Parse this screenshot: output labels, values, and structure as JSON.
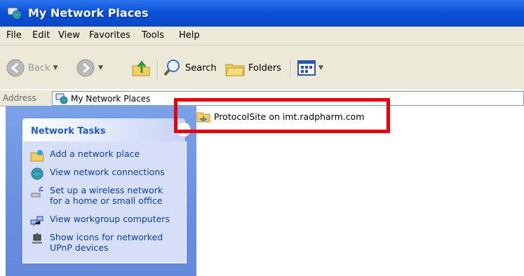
{
  "window": {
    "title": "My Network Places"
  },
  "menu": {
    "items": [
      "File",
      "Edit",
      "View",
      "Favorites",
      "Tools",
      "Help"
    ]
  },
  "toolbar": {
    "back_label": "Back",
    "search_label": "Search",
    "folders_label": "Folders",
    "icons": [
      "back-arrow-icon",
      "forward-arrow-icon",
      "up-folder-icon",
      "search-icon",
      "folders-icon",
      "views-icon"
    ]
  },
  "address": {
    "label": "Address",
    "value": "My Network Places"
  },
  "tasks": {
    "title": "Network Tasks",
    "items": [
      {
        "label": "Add a network place",
        "icon": "add-network-place-icon"
      },
      {
        "label": "View network connections",
        "icon": "network-connections-icon"
      },
      {
        "label": "Set up a wireless network for a home or small office",
        "icon": "wireless-network-icon"
      },
      {
        "label": "View workgroup computers",
        "icon": "workgroup-computers-icon"
      },
      {
        "label": "Show icons for networked UPnP devices",
        "icon": "upnp-devices-icon"
      }
    ]
  },
  "content": {
    "items": [
      {
        "label": "ProtocolSite on imt.radpharm.com",
        "icon": "network-folder-icon"
      }
    ]
  },
  "colors": {
    "titlebar": "#0a52d8",
    "highlight": "#e8000b",
    "task_link": "#0a3fa8",
    "panel_title": "#215dc6"
  }
}
